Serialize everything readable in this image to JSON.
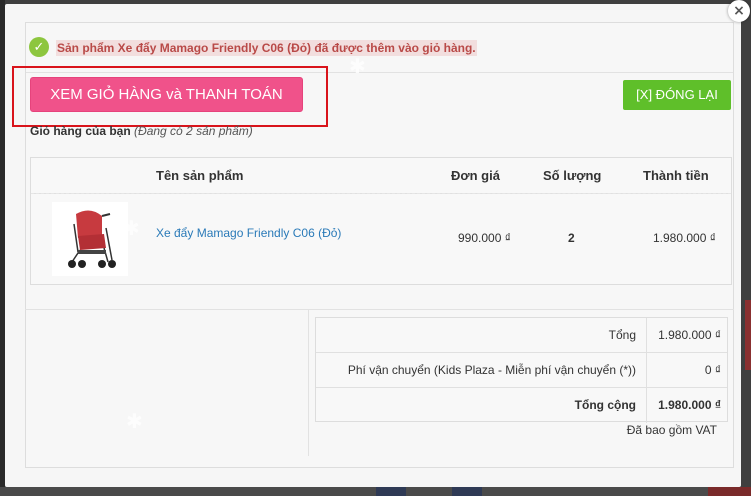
{
  "notice": {
    "message": "Sản phẩm Xe đẩy Mamago Friendly C06 (Đỏ) đã được thêm vào giỏ hàng."
  },
  "actions": {
    "view_cart_label": "XEM GIỎ HÀNG và THANH TOÁN",
    "close_label": "[X] ĐÓNG LẠI",
    "close_icon": "×"
  },
  "cart": {
    "heading": "Giỏ hàng của bạn",
    "count_text": "(Đang có 2 sản phẩm)",
    "columns": {
      "name": "Tên sản phẩm",
      "price": "Đơn giá",
      "qty": "Số lượng",
      "total": "Thành tiền"
    },
    "items": [
      {
        "name": "Xe đẩy Mamago Friendly C06 (Đỏ)",
        "price": "990.000 ₫",
        "qty": "2",
        "total": "1.980.000 ₫"
      }
    ]
  },
  "summary": {
    "subtotal_label": "Tổng",
    "subtotal_value": "1.980.000 ₫",
    "shipping_label": "Phí vận chuyển (Kids Plaza - Miễn phí vận chuyển (*))",
    "shipping_value": "0 ₫",
    "grand_label": "Tổng cộng",
    "grand_value": "1.980.000 ₫",
    "vat_note": "Đã bao gồm VAT"
  },
  "colors": {
    "accent_pink": "#f0528a",
    "accent_green": "#5fbf2a",
    "highlight_red": "#d9141b",
    "link_blue": "#2a7ab8"
  }
}
